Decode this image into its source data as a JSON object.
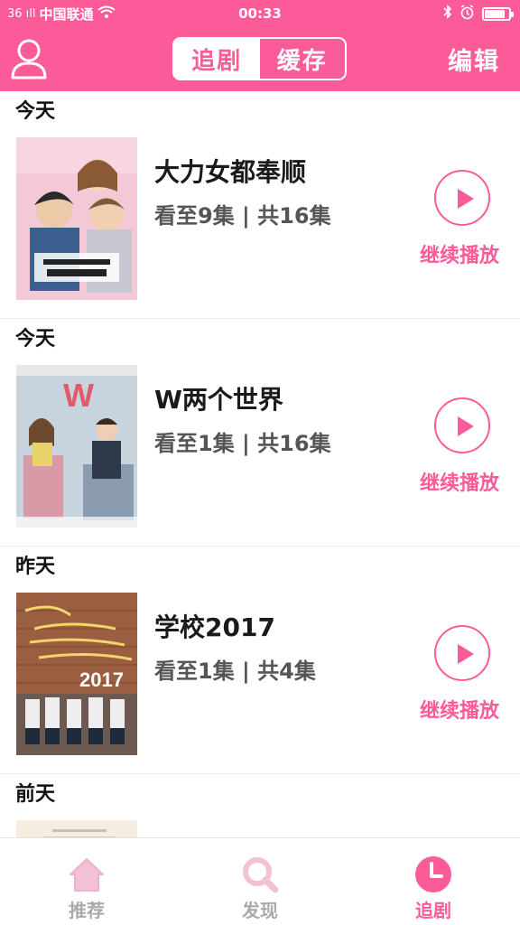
{
  "status_bar": {
    "signal": "36 ıll",
    "carrier": "中国联通",
    "time": "00:33",
    "battery_level": 0.85
  },
  "header": {
    "tabs": [
      {
        "label": "追剧",
        "active": true
      },
      {
        "label": "缓存",
        "active": false
      }
    ],
    "edit_label": "编辑"
  },
  "list": {
    "continue_label": "继续播放",
    "items": [
      {
        "date": "今天",
        "title": "大力女都奉顺",
        "progress": "看至9集 | 共16集"
      },
      {
        "date": "今天",
        "title": "W两个世界",
        "progress": "看至1集 | 共16集"
      },
      {
        "date": "昨天",
        "title": "学校2017",
        "progress": "看至1集 | 共4集"
      },
      {
        "date": "前天"
      }
    ]
  },
  "tabbar": {
    "tabs": [
      {
        "label": "推荐",
        "icon": "home-icon",
        "active": false
      },
      {
        "label": "发现",
        "icon": "search-icon",
        "active": false
      },
      {
        "label": "追剧",
        "icon": "clock-icon",
        "active": true
      }
    ]
  },
  "colors": {
    "accent": "#fb5b98",
    "poster1": "#f2c6d6",
    "poster2": "#b7c8d6",
    "poster3": "#9a5c3d"
  }
}
